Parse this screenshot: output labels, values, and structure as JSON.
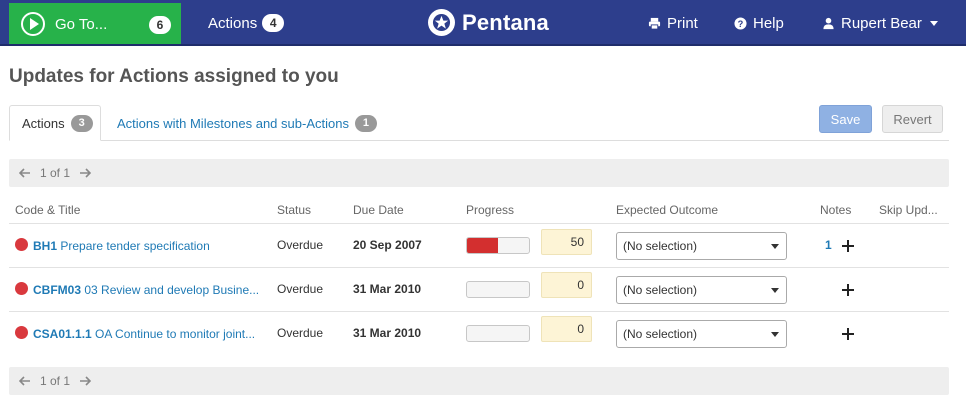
{
  "topbar": {
    "goto_label": "Go To...",
    "goto_count": "6",
    "actions_label": "Actions",
    "actions_count": "4",
    "brand": "Pentana",
    "print_label": "Print",
    "help_label": "Help",
    "user_label": "Rupert Bear"
  },
  "page": {
    "title": "Updates for Actions assigned to you"
  },
  "tabs": [
    {
      "label": "Actions",
      "count": "3"
    },
    {
      "label": "Actions with Milestones and sub-Actions",
      "count": "1"
    }
  ],
  "buttons": {
    "save": "Save",
    "revert": "Revert"
  },
  "pager": {
    "text": "1 of 1"
  },
  "table": {
    "headers": {
      "code_title": "Code & Title",
      "status": "Status",
      "due_date": "Due Date",
      "progress": "Progress",
      "expected_outcome": "Expected Outcome",
      "notes": "Notes",
      "skip": "Skip Upd..."
    },
    "rows": [
      {
        "code": "BH1",
        "title": "Prepare tender specification",
        "status": "Overdue",
        "due": "20 Sep 2007",
        "progress": 50,
        "progress_text": "50",
        "outcome": "(No selection)",
        "notes": "1",
        "status_color": "#d9393e"
      },
      {
        "code": "CBFM03",
        "title": "03 Review and develop Busine...",
        "status": "Overdue",
        "due": "31 Mar 2010",
        "progress": 0,
        "progress_text": "0",
        "outcome": "(No selection)",
        "notes": "",
        "status_color": "#d9393e"
      },
      {
        "code": "CSA01.1.1",
        "title": "OA Continue to monitor joint...",
        "status": "Overdue",
        "due": "31 Mar 2010",
        "progress": 0,
        "progress_text": "0",
        "outcome": "(No selection)",
        "notes": "",
        "status_color": "#d9393e"
      }
    ]
  },
  "icons": {
    "goto": "play-circle-icon",
    "brand": "star-logo-icon",
    "print": "printer-icon",
    "help": "question-circle-icon",
    "user": "user-icon",
    "prev": "arrow-left-icon",
    "next": "arrow-right-icon",
    "add_note": "plus-icon"
  },
  "colors": {
    "nav_bg": "#2d3e8c",
    "goto_bg": "#27b24a",
    "link": "#1f7ab5",
    "overdue": "#d9393e",
    "progress_fill": "#d32f2f"
  }
}
